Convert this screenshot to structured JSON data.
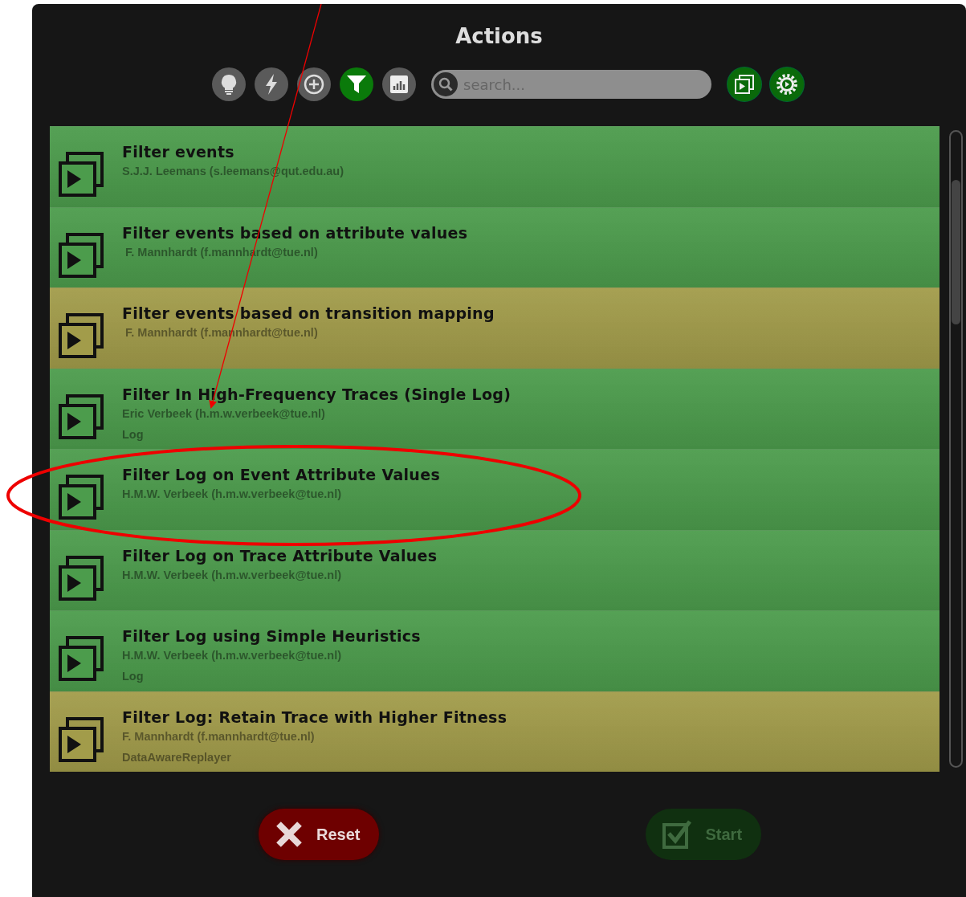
{
  "window": {
    "title": "Actions"
  },
  "toolbar": {
    "filters": [
      {
        "kind": "bulb",
        "selected": false
      },
      {
        "kind": "bolt",
        "selected": false
      },
      {
        "kind": "plus",
        "selected": false
      },
      {
        "kind": "filter",
        "selected": true
      },
      {
        "kind": "chart",
        "selected": false
      }
    ],
    "search": {
      "placeholder": "search..."
    },
    "views": [
      {
        "kind": "stack"
      },
      {
        "kind": "gear"
      }
    ]
  },
  "actions": [
    {
      "title": "Filter events",
      "author": "S.J.J. Leemans (s.leemans@qut.edu.au)",
      "color": "#4c9c4c"
    },
    {
      "title": "Filter events based on attribute values",
      "author": " F. Mannhardt (f.mannhardt@tue.nl)",
      "color": "#4c9c4c"
    },
    {
      "title": "Filter events based on transition mapping",
      "author": " F. Mannhardt (f.mannhardt@tue.nl)",
      "color": "#a29c4a"
    },
    {
      "title": "Filter In High-Frequency Traces (Single Log)",
      "author": "Eric Verbeek (h.m.w.verbeek@tue.nl)",
      "extra": "Log",
      "color": "#4c9c4c"
    },
    {
      "title": "Filter Log on Event Attribute Values",
      "author": "H.M.W. Verbeek (h.m.w.verbeek@tue.nl)",
      "color": "#4c9c4c"
    },
    {
      "title": "Filter Log on Trace Attribute Values",
      "author": "H.M.W. Verbeek (h.m.w.verbeek@tue.nl)",
      "color": "#4c9c4c"
    },
    {
      "title": "Filter Log using Simple Heuristics",
      "author": "H.M.W. Verbeek (h.m.w.verbeek@tue.nl)",
      "extra": "Log",
      "color": "#4c9c4c"
    },
    {
      "title": "Filter Log: Retain Trace with Higher Fitness",
      "author": "F. Mannhardt (f.mannhardt@tue.nl)",
      "extra": "DataAwareReplayer",
      "color": "#a29c4a"
    }
  ],
  "buttons": [
    {
      "kind": "reset",
      "label": "Reset",
      "disabled": false
    },
    {
      "kind": "start",
      "label": "Start",
      "disabled": true
    }
  ]
}
